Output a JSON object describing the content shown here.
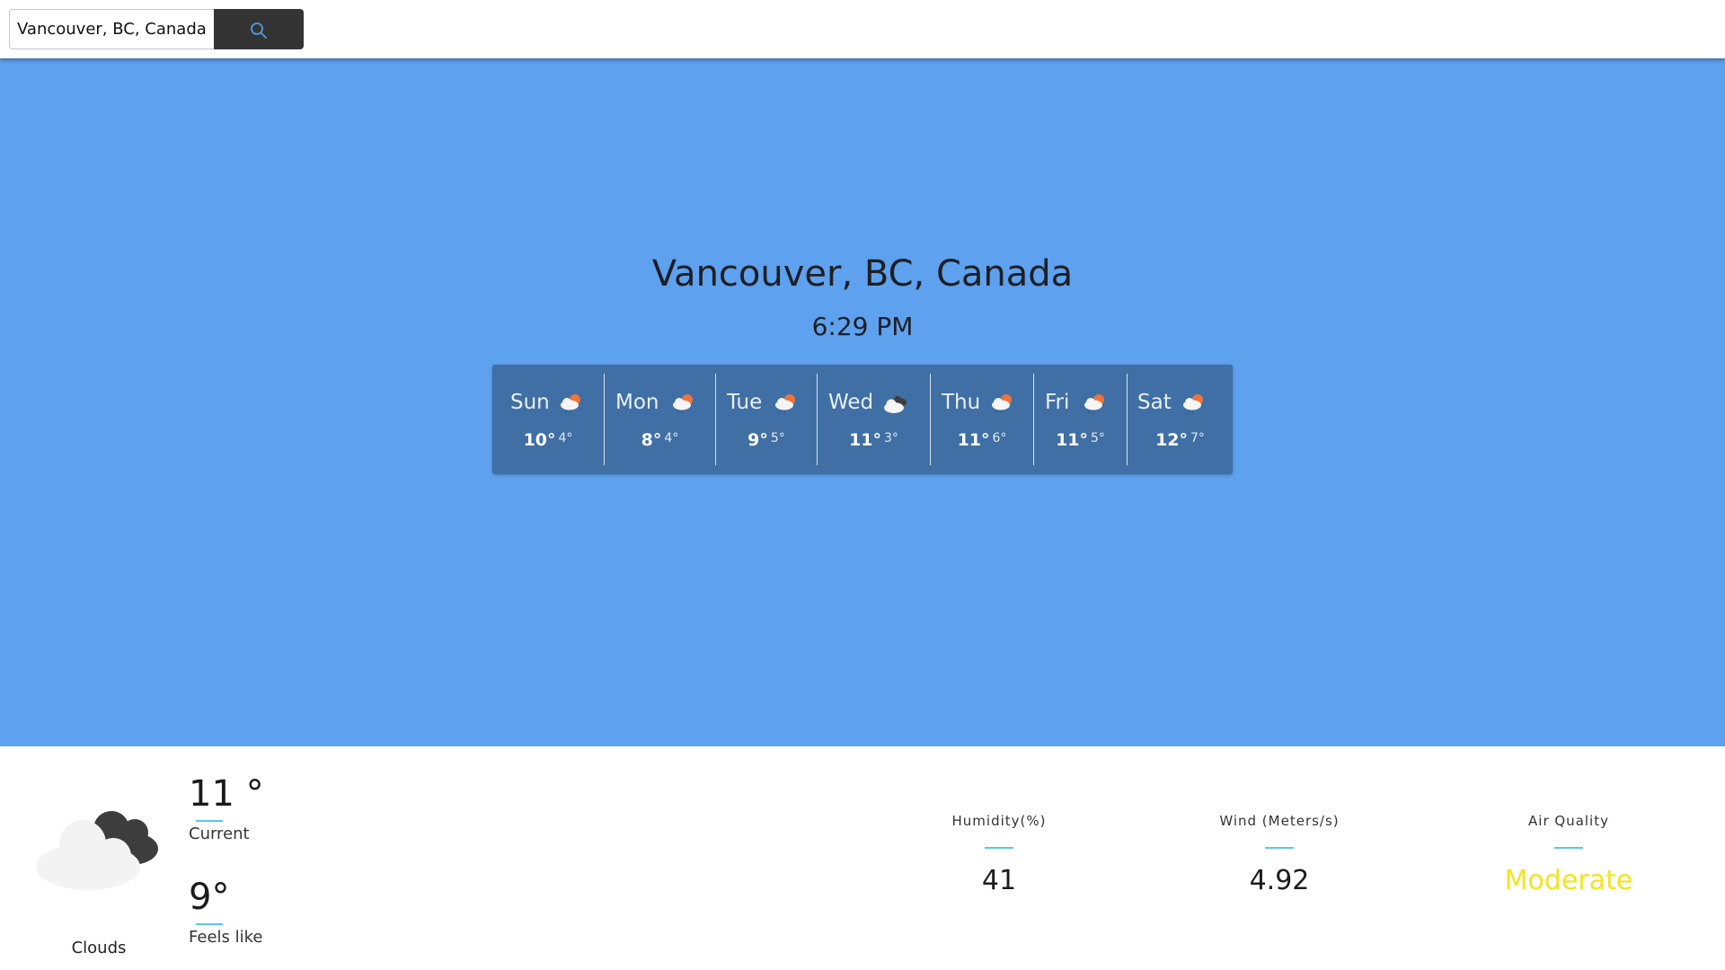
{
  "search": {
    "value": "Vancouver, BC, Canada",
    "button_icon": "search-icon"
  },
  "location": {
    "city": "Vancouver, BC, Canada",
    "time": "6:29 PM"
  },
  "forecast": [
    {
      "day": "Sun",
      "hi": "10°",
      "lo": "4°",
      "icon": "rain-sun-icon"
    },
    {
      "day": "Mon",
      "hi": "8°",
      "lo": "4°",
      "icon": "rain-sun-icon"
    },
    {
      "day": "Tue",
      "hi": "9°",
      "lo": "5°",
      "icon": "rain-sun-icon"
    },
    {
      "day": "Wed",
      "hi": "11°",
      "lo": "3°",
      "icon": "cloudy-icon"
    },
    {
      "day": "Thu",
      "hi": "11°",
      "lo": "6°",
      "icon": "rain-sun-icon"
    },
    {
      "day": "Fri",
      "hi": "11°",
      "lo": "5°",
      "icon": "rain-sun-icon"
    },
    {
      "day": "Sat",
      "hi": "12°",
      "lo": "7°",
      "icon": "rain-sun-icon"
    }
  ],
  "current": {
    "condition": "Clouds",
    "condition_icon": "clouds-icon",
    "temp": "11 °",
    "temp_label": "Current",
    "feels_like": "9°",
    "feels_like_label": "Feels like"
  },
  "stats": {
    "humidity_label": "Humidity(%)",
    "humidity_value": "41",
    "wind_label": "Wind (Meters/s)",
    "wind_value": "4.92",
    "air_label": "Air Quality",
    "air_value": "Moderate"
  },
  "colors": {
    "hero_bg": "#5ea1ee",
    "forecast_bg": "#3f6fa4",
    "accent_line": "#5bc6e8",
    "air_quality_moderate": "#f2e41f",
    "search_button": "#343434"
  }
}
